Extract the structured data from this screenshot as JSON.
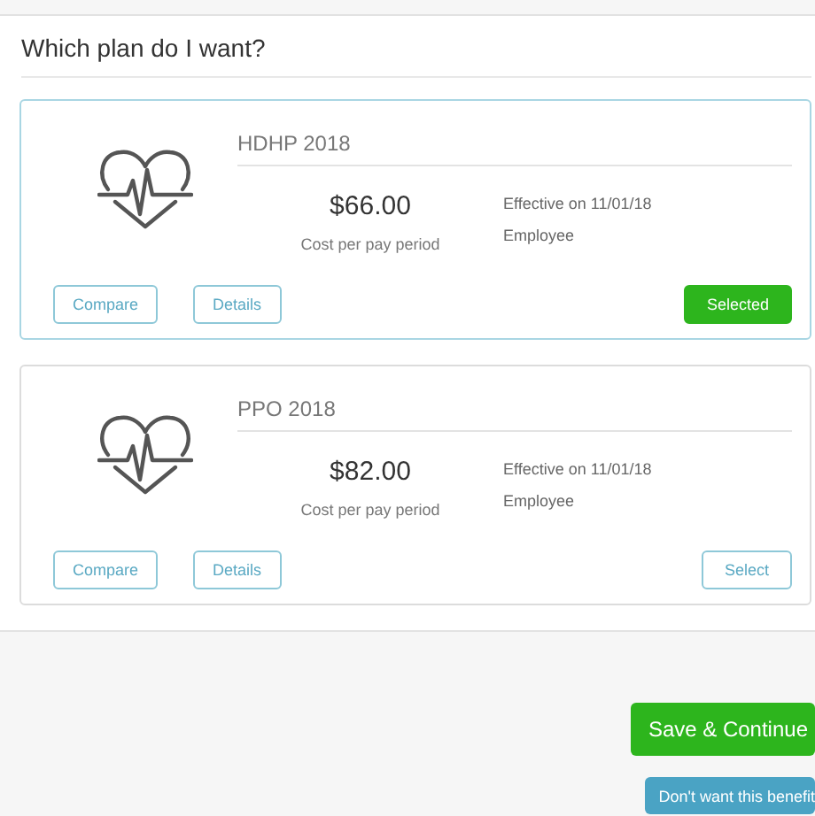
{
  "section": {
    "title": "Which plan do I want?"
  },
  "plans": [
    {
      "name": "HDHP 2018",
      "price": "$66.00",
      "price_label": "Cost per pay period",
      "effective": "Effective on 11/01/18",
      "coverage": "Employee",
      "compare": "Compare",
      "details": "Details",
      "action": "Selected",
      "selected": true
    },
    {
      "name": "PPO 2018",
      "price": "$82.00",
      "price_label": "Cost per pay period",
      "effective": "Effective on 11/01/18",
      "coverage": "Employee",
      "compare": "Compare",
      "details": "Details",
      "action": "Select",
      "selected": false
    }
  ],
  "footer": {
    "save": "Save & Continue",
    "decline": "Don't want this benefit"
  }
}
